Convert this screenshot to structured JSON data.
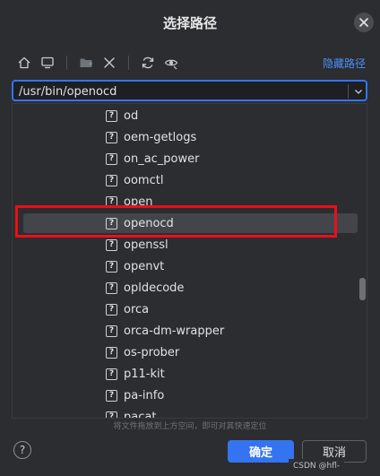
{
  "dialog": {
    "title": "选择路径",
    "hide_path_label": "隐藏路径",
    "path_value": "/usr/bin/openocd",
    "drop_hint": "将文件拖放到上方空间，即可对其快速定位",
    "ok_label": "确定",
    "cancel_label": "取消",
    "help_label": "?"
  },
  "toolbar": {
    "icons": [
      "home-icon",
      "desktop-icon",
      "new-folder-icon",
      "delete-icon",
      "refresh-icon",
      "show-hidden-icon"
    ]
  },
  "tree": {
    "items": [
      {
        "name": "od",
        "selected": false
      },
      {
        "name": "oem-getlogs",
        "selected": false
      },
      {
        "name": "on_ac_power",
        "selected": false
      },
      {
        "name": "oomctl",
        "selected": false
      },
      {
        "name": "open",
        "selected": false
      },
      {
        "name": "openocd",
        "selected": true
      },
      {
        "name": "openssl",
        "selected": false
      },
      {
        "name": "openvt",
        "selected": false
      },
      {
        "name": "opldecode",
        "selected": false
      },
      {
        "name": "orca",
        "selected": false
      },
      {
        "name": "orca-dm-wrapper",
        "selected": false
      },
      {
        "name": "os-prober",
        "selected": false
      },
      {
        "name": "p11-kit",
        "selected": false
      },
      {
        "name": "pa-info",
        "selected": false
      },
      {
        "name": "pacat",
        "selected": false
      }
    ],
    "file_icon_glyph": "?"
  },
  "watermark": "CSDN @hfl-",
  "colors": {
    "background": "#2b2d30",
    "accent": "#3574f0",
    "link": "#4c8ffb",
    "highlight_box": "#e8101a",
    "selected_row": "#43454a"
  }
}
